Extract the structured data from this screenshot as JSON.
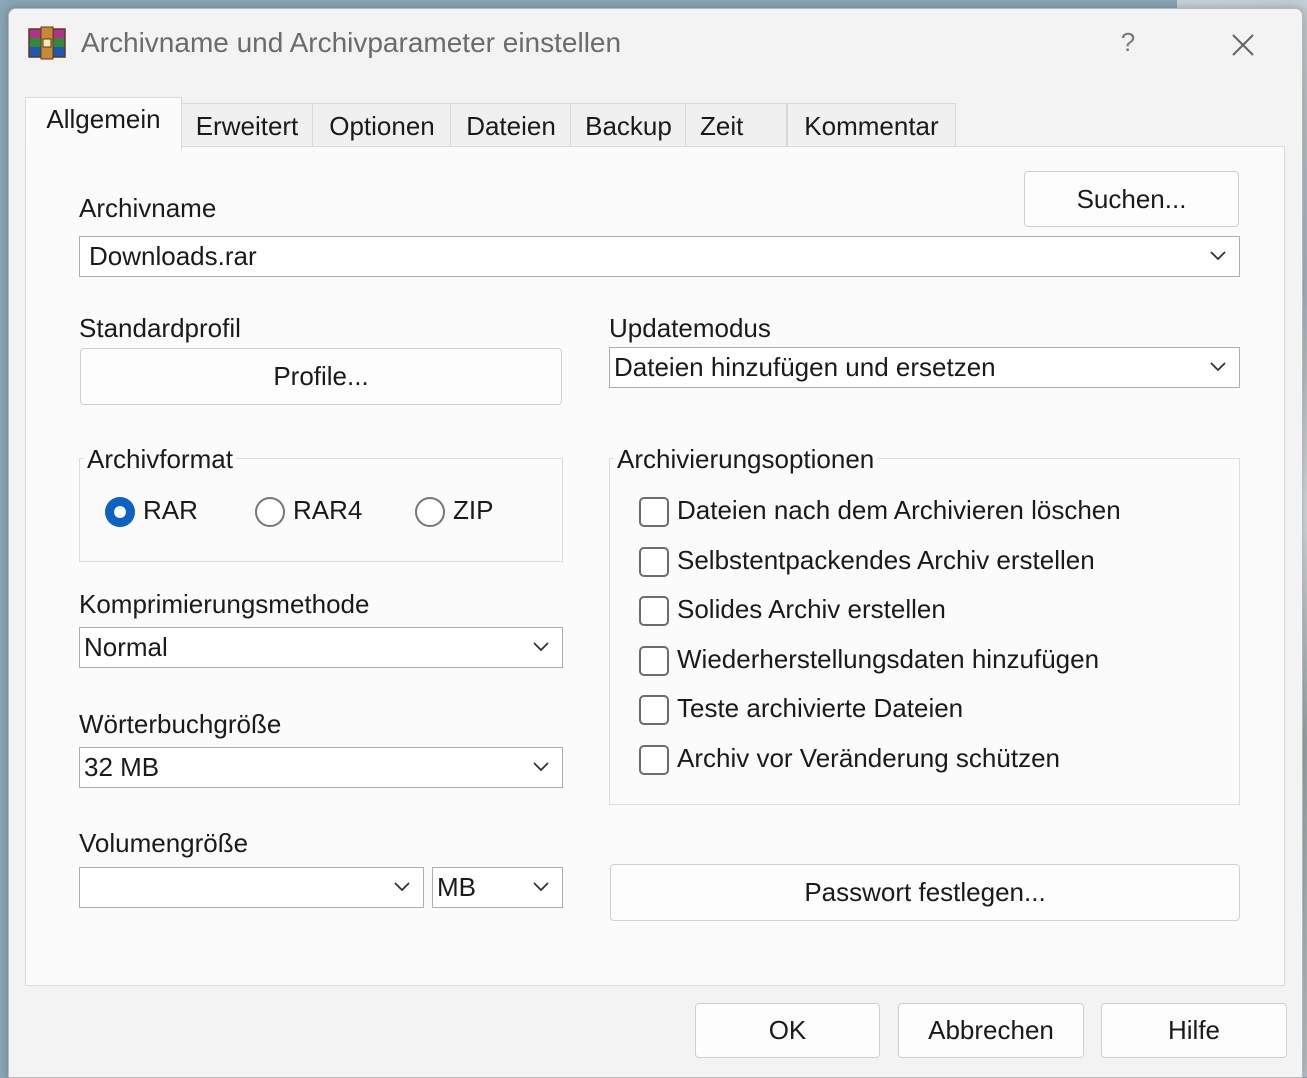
{
  "window": {
    "title": "Archivname und Archivparameter einstellen",
    "help_label": "?"
  },
  "tabs": [
    "Allgemein",
    "Erweitert",
    "Optionen",
    "Dateien",
    "Backup",
    "Zeit",
    "Kommentar"
  ],
  "active_tab": "Allgemein",
  "general": {
    "archive_name_label": "Archivname",
    "browse_label": "Suchen...",
    "archive_name_value": "Downloads.rar",
    "default_profile_label": "Standardprofil",
    "profiles_label": "Profile...",
    "update_mode_label": "Updatemodus",
    "update_mode_value": "Dateien hinzufügen und ersetzen",
    "archive_format_label": "Archivformat",
    "formats": [
      {
        "label": "RAR",
        "selected": true
      },
      {
        "label": "RAR4",
        "selected": false
      },
      {
        "label": "ZIP",
        "selected": false
      }
    ],
    "compression_label": "Komprimierungsmethode",
    "compression_value": "Normal",
    "dictionary_label": "Wörterbuchgröße",
    "dictionary_value": "32 MB",
    "volume_label": "Volumengröße",
    "volume_value": "",
    "volume_unit": "MB",
    "options_label": "Archivierungsoptionen",
    "options": [
      {
        "label": "Dateien nach dem Archivieren löschen",
        "checked": false
      },
      {
        "label": "Selbstentpackendes Archiv erstellen",
        "checked": false
      },
      {
        "label": "Solides Archiv erstellen",
        "checked": false
      },
      {
        "label": "Wiederherstellungsdaten hinzufügen",
        "checked": false
      },
      {
        "label": "Teste archivierte Dateien",
        "checked": false
      },
      {
        "label": "Archiv vor Veränderung schützen",
        "checked": false
      }
    ],
    "password_label": "Passwort festlegen..."
  },
  "footer": {
    "ok_label": "OK",
    "cancel_label": "Abbrechen",
    "help_label": "Hilfe"
  },
  "colors": {
    "accent": "#0a63c4",
    "window_bg": "#f3f3f3",
    "panel_bg": "#fbfbfb"
  }
}
